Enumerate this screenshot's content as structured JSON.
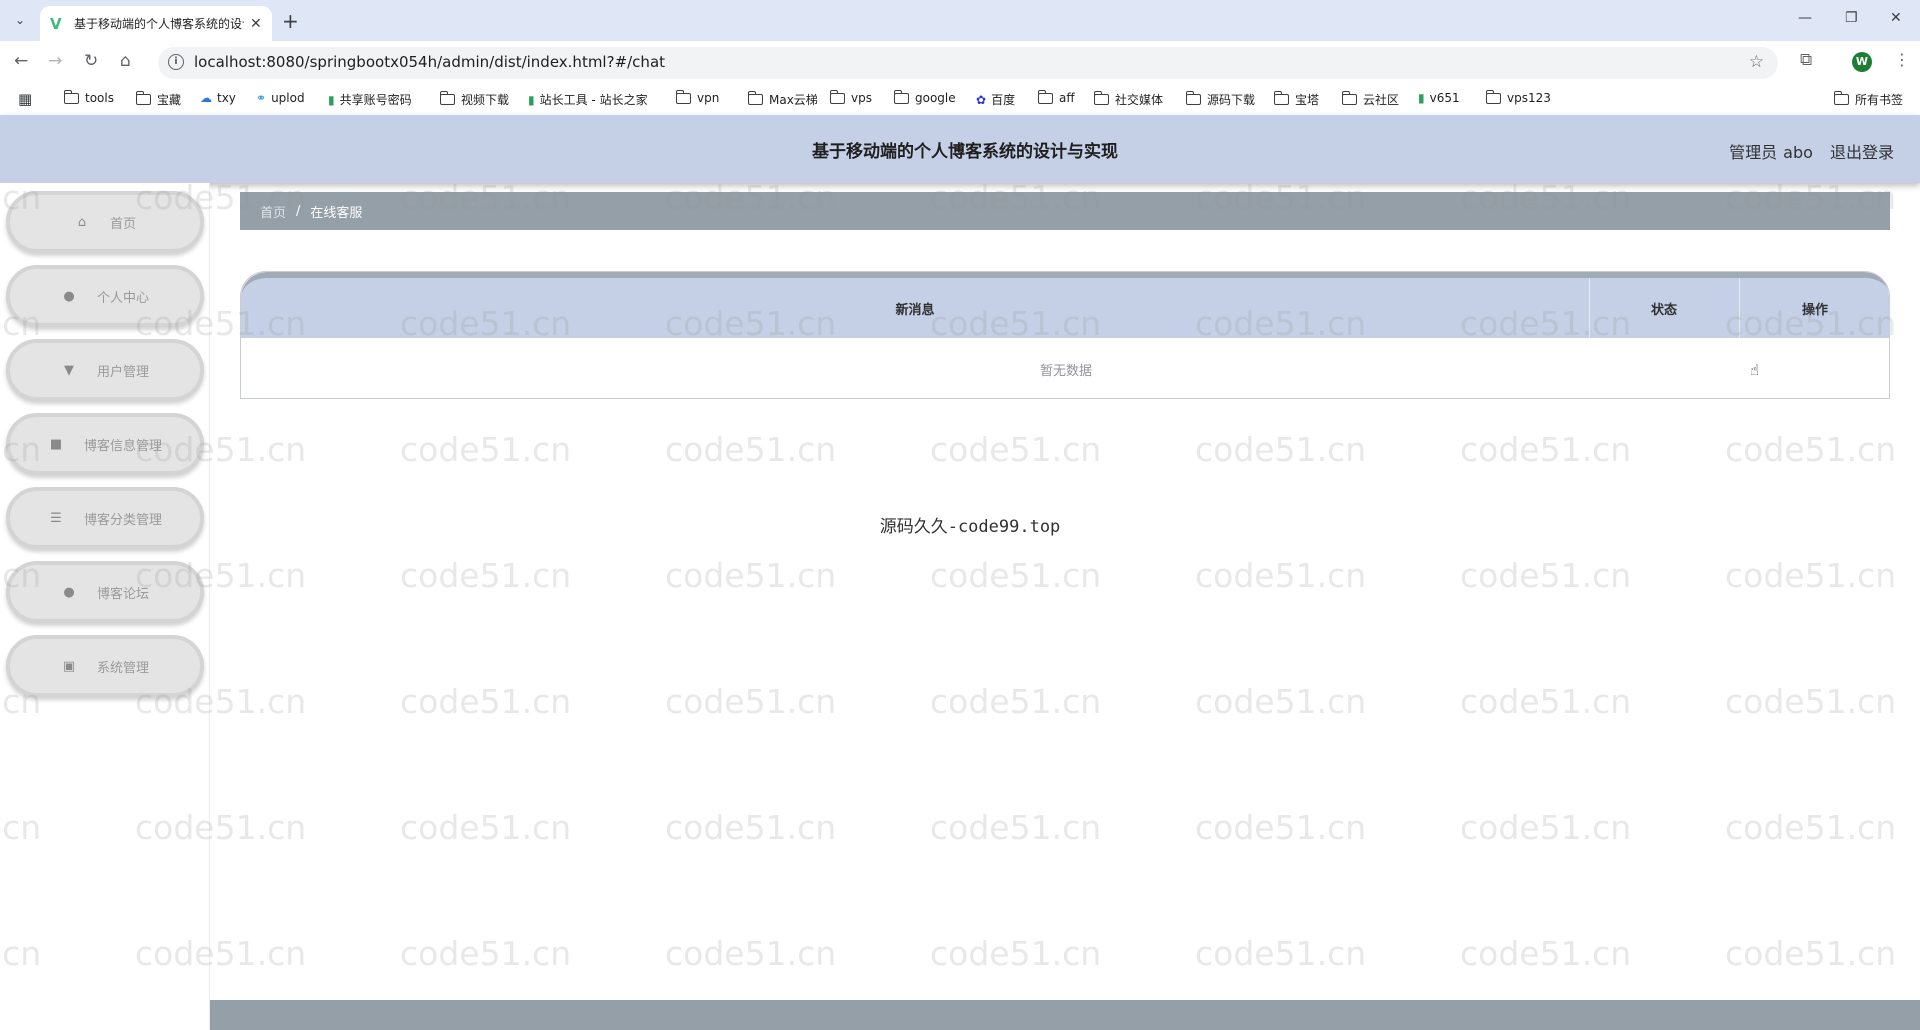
{
  "browser": {
    "tab_title": "基于移动端的个人博客系统的设计与实现",
    "new_tab": "+",
    "url": "localhost:8080/springbootx054h/admin/dist/index.html?#/chat",
    "profile_initial": "W",
    "bookmarks": [
      {
        "label": "tools",
        "icon": "folder-icon"
      },
      {
        "label": "宝藏",
        "icon": "folder-icon"
      },
      {
        "label": "txy",
        "icon": "cloud-icon"
      },
      {
        "label": "uplod",
        "icon": "link-icon"
      },
      {
        "label": "共享账号密码",
        "icon": "site-icon"
      },
      {
        "label": "视频下载",
        "icon": "folder-icon"
      },
      {
        "label": "站长工具 - 站长之家",
        "icon": "site-icon"
      },
      {
        "label": "vpn",
        "icon": "folder-icon"
      },
      {
        "label": "Max云梯",
        "icon": "folder-icon"
      },
      {
        "label": "vps",
        "icon": "folder-icon"
      },
      {
        "label": "google",
        "icon": "folder-icon"
      },
      {
        "label": "百度",
        "icon": "baidu-icon"
      },
      {
        "label": "aff",
        "icon": "folder-icon"
      },
      {
        "label": "社交媒体",
        "icon": "folder-icon"
      },
      {
        "label": "源码下载",
        "icon": "folder-icon"
      },
      {
        "label": "宝塔",
        "icon": "folder-icon"
      },
      {
        "label": "云社区",
        "icon": "folder-icon"
      },
      {
        "label": "v651",
        "icon": "site-icon"
      },
      {
        "label": "vps123",
        "icon": "folder-icon"
      }
    ],
    "all_bookmarks": "所有书签"
  },
  "header": {
    "title": "基于移动端的个人博客系统的设计与实现",
    "role": "管理员",
    "username": "abo",
    "logout": "退出登录"
  },
  "sidebar": {
    "items": [
      {
        "label": "首页",
        "icon": "home-icon"
      },
      {
        "label": "个人中心",
        "icon": "user-icon"
      },
      {
        "label": "用户管理",
        "icon": "pin-icon"
      },
      {
        "label": "博客信息管理",
        "icon": "briefcase-icon"
      },
      {
        "label": "博客分类管理",
        "icon": "list-icon"
      },
      {
        "label": "博客论坛",
        "icon": "user-icon"
      },
      {
        "label": "系统管理",
        "icon": "clipboard-icon"
      }
    ]
  },
  "breadcrumb": {
    "home": "首页",
    "separator": "/",
    "current": "在线客服"
  },
  "table": {
    "columns": [
      "新消息",
      "状态",
      "操作"
    ],
    "empty_text": "暂无数据"
  },
  "footer": {
    "text": "源码久久-code99.top"
  },
  "watermark": {
    "text": "code51.cn"
  }
}
